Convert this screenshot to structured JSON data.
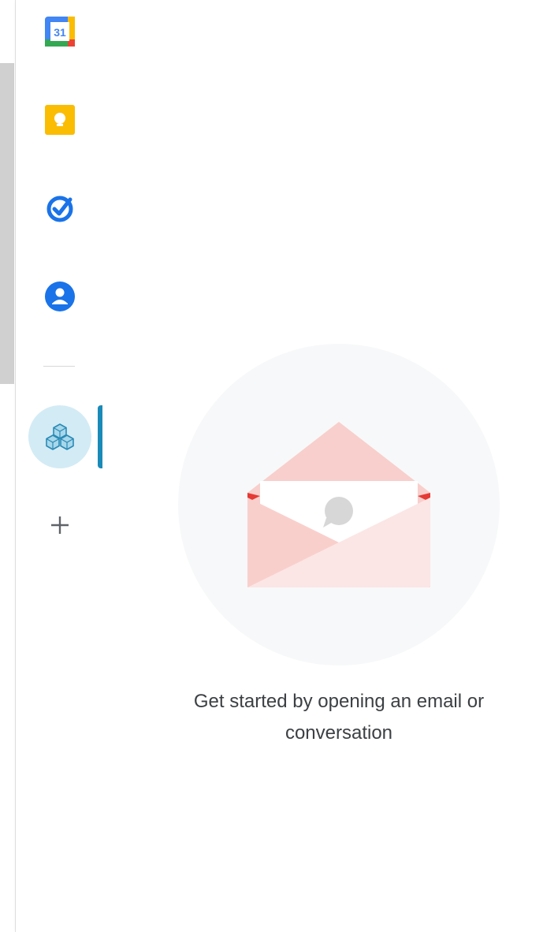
{
  "sidebar": {
    "apps": [
      {
        "name": "calendar",
        "icon": "calendar-icon",
        "day": "31"
      },
      {
        "name": "keep",
        "icon": "lightbulb-icon"
      },
      {
        "name": "tasks",
        "icon": "tasks-check-icon"
      },
      {
        "name": "contacts",
        "icon": "person-icon"
      }
    ],
    "active_addon": {
      "icon": "cubes-icon"
    },
    "add_icon": "plus-icon"
  },
  "main": {
    "empty_state": {
      "icon": "envelope-chat-icon",
      "message": "Get started by opening an email or conversation"
    }
  },
  "colors": {
    "accent": "#1a8ab8",
    "active_bg": "#d3ebf5",
    "envelope": "#f8cfcc",
    "text": "#3c4043"
  }
}
